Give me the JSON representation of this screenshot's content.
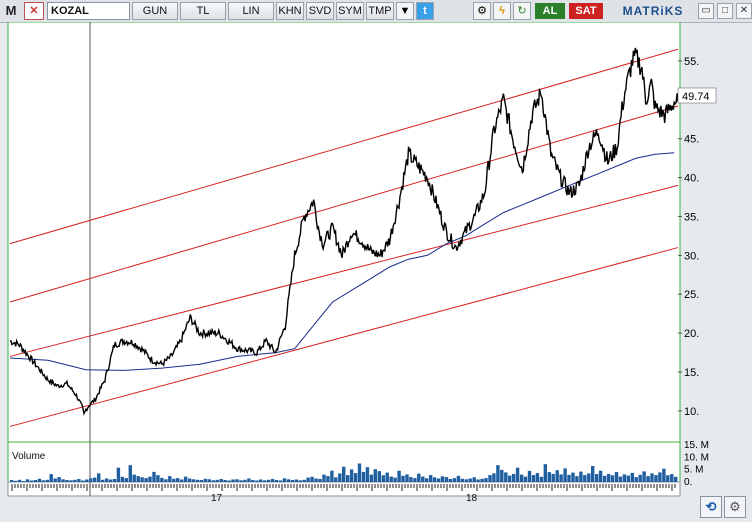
{
  "toolbar": {
    "m_label": "M",
    "symbol": "KOZAL",
    "buttons": [
      "GUN",
      "TL",
      "LIN",
      "KHN",
      "SVD",
      "SYM",
      "TMP"
    ],
    "al_label": "AL",
    "sat_label": "SAT",
    "logo": "MATRiKS"
  },
  "colors": {
    "price_line": "#000000",
    "moving_average": "#1a2a8c",
    "channel_lines": "#d42020",
    "volume_bars": "#1f5fa0",
    "panel_border": "#3cb23c"
  },
  "chart_data": {
    "type": "line",
    "symbol": "KOZAL",
    "current_price": "49.74",
    "y_ticks": [
      "55.",
      "45.",
      "40.",
      "35.",
      "30.",
      "25.",
      "20.",
      "15.",
      "10."
    ],
    "ylim": [
      6,
      60
    ],
    "x_tick_labels": [
      "17",
      "18"
    ],
    "price_series": {
      "x": [
        0,
        5,
        10,
        15,
        20,
        25,
        30,
        35,
        38,
        39,
        40,
        42,
        45,
        50,
        55,
        60,
        65,
        70,
        75,
        80,
        85,
        90,
        95,
        100,
        110,
        120,
        130,
        135,
        140,
        145,
        150,
        155,
        160,
        163,
        165,
        170,
        175,
        180,
        185,
        190,
        195,
        200,
        205,
        210,
        220,
        230,
        235,
        240,
        245,
        250,
        255,
        260,
        265,
        270,
        275,
        280,
        285,
        290,
        295,
        300,
        305,
        310,
        315,
        320,
        322,
        324,
        326,
        328,
        330,
        333,
        335,
        338,
        340,
        345,
        350,
        352
      ],
      "y": [
        19,
        18.5,
        17,
        15.5,
        14,
        13.2,
        13.5,
        12,
        10.5,
        9.5,
        10.2,
        10.8,
        11.5,
        14,
        18.5,
        19,
        18.8,
        17.8,
        16.5,
        16,
        17,
        19,
        22,
        20,
        20,
        18,
        17.5,
        19,
        17.5,
        21,
        30,
        35,
        37,
        33,
        31.5,
        33.5,
        30,
        33,
        32,
        30.5,
        30,
        32,
        37,
        43,
        40,
        33,
        31,
        33,
        35,
        38,
        46,
        50,
        45,
        41,
        48,
        51,
        43,
        40,
        38,
        39,
        44,
        46,
        42,
        44,
        48,
        51,
        53,
        55,
        55.5,
        54,
        50,
        52,
        49,
        48,
        49.7,
        49.74
      ],
      "xlim": [
        0,
        352
      ]
    },
    "moving_average": {
      "x": [
        0,
        20,
        40,
        60,
        80,
        100,
        120,
        140,
        150,
        160,
        170,
        180,
        190,
        200,
        210,
        220,
        230,
        240,
        250,
        260,
        270,
        280,
        290,
        300,
        310,
        320,
        330,
        340,
        350
      ],
      "y": [
        16.8,
        16.5,
        15.3,
        15.2,
        15.5,
        16,
        17,
        17.5,
        18,
        21,
        24,
        25.5,
        27,
        28.5,
        29.5,
        30,
        31.5,
        32.5,
        34,
        35.5,
        36.5,
        37.5,
        38.5,
        39.5,
        40.5,
        41.5,
        42.5,
        43,
        43.2
      ]
    },
    "channel_lines": [
      {
        "y_start": 31.5,
        "y_end": 56.5
      },
      {
        "y_start": 24,
        "y_end": 49.2
      },
      {
        "y_start": 17,
        "y_end": 39
      },
      {
        "y_start": 8,
        "y_end": 31
      }
    ],
    "volume": {
      "label": "Volume",
      "y_ticks": [
        "15. M",
        "10. M",
        "5. M",
        "0."
      ],
      "values_m": [
        0.8,
        0.5,
        0.9,
        0.4,
        1.1,
        0.6,
        0.8,
        1.3,
        0.7,
        0.9,
        3.2,
        1.4,
        2.0,
        1.1,
        0.8,
        0.7,
        0.9,
        1.2,
        0.6,
        1.0,
        1.5,
        1.8,
        3.5,
        0.9,
        1.4,
        1.0,
        1.2,
        5.8,
        2.1,
        1.6,
        6.8,
        3.0,
        2.4,
        1.9,
        1.6,
        2.2,
        4.1,
        2.8,
        1.7,
        1.1,
        2.4,
        1.3,
        1.6,
        1.0,
        2.2,
        1.4,
        1.1,
        0.9,
        0.8,
        1.3,
        1.1,
        0.7,
        0.9,
        1.2,
        0.8,
        0.6,
        1.0,
        1.1,
        0.7,
        0.9,
        1.4,
        0.8,
        0.6,
        1.0,
        0.7,
        0.9,
        1.2,
        0.8,
        0.6,
        1.5,
        1.1,
        0.8,
        1.0,
        0.7,
        0.9,
        1.8,
        2.1,
        1.4,
        1.2,
        3.0,
        2.4,
        4.6,
        1.9,
        3.5,
        6.2,
        2.8,
        5.1,
        3.6,
        7.5,
        4.1,
        6.0,
        3.0,
        5.2,
        4.4,
        2.7,
        3.8,
        2.2,
        1.8,
        4.6,
        2.5,
        3.1,
        2.0,
        1.6,
        3.4,
        2.2,
        1.5,
        2.8,
        1.9,
        1.4,
        2.3,
        2.0,
        1.2,
        1.6,
        2.5,
        1.3,
        1.1,
        1.4,
        1.9,
        1.0,
        1.3,
        1.6,
        2.8,
        3.5,
        6.8,
        4.9,
        3.9,
        2.6,
        3.3,
        5.8,
        3.0,
        2.2,
        4.5,
        2.8,
        3.6,
        2.1,
        7.2,
        4.0,
        3.3,
        4.8,
        3.1,
        5.5,
        2.9,
        3.8,
        2.4,
        4.2,
        2.8,
        3.5,
        6.5,
        3.2,
        4.6,
        2.5,
        3.3,
        2.7,
        4.0,
        2.2,
        3.1,
        2.6,
        3.7,
        2.0,
        2.9,
        4.3,
        2.4,
        3.5,
        2.8,
        3.9,
        5.4,
        2.7,
        3.2,
        2.1
      ]
    }
  }
}
